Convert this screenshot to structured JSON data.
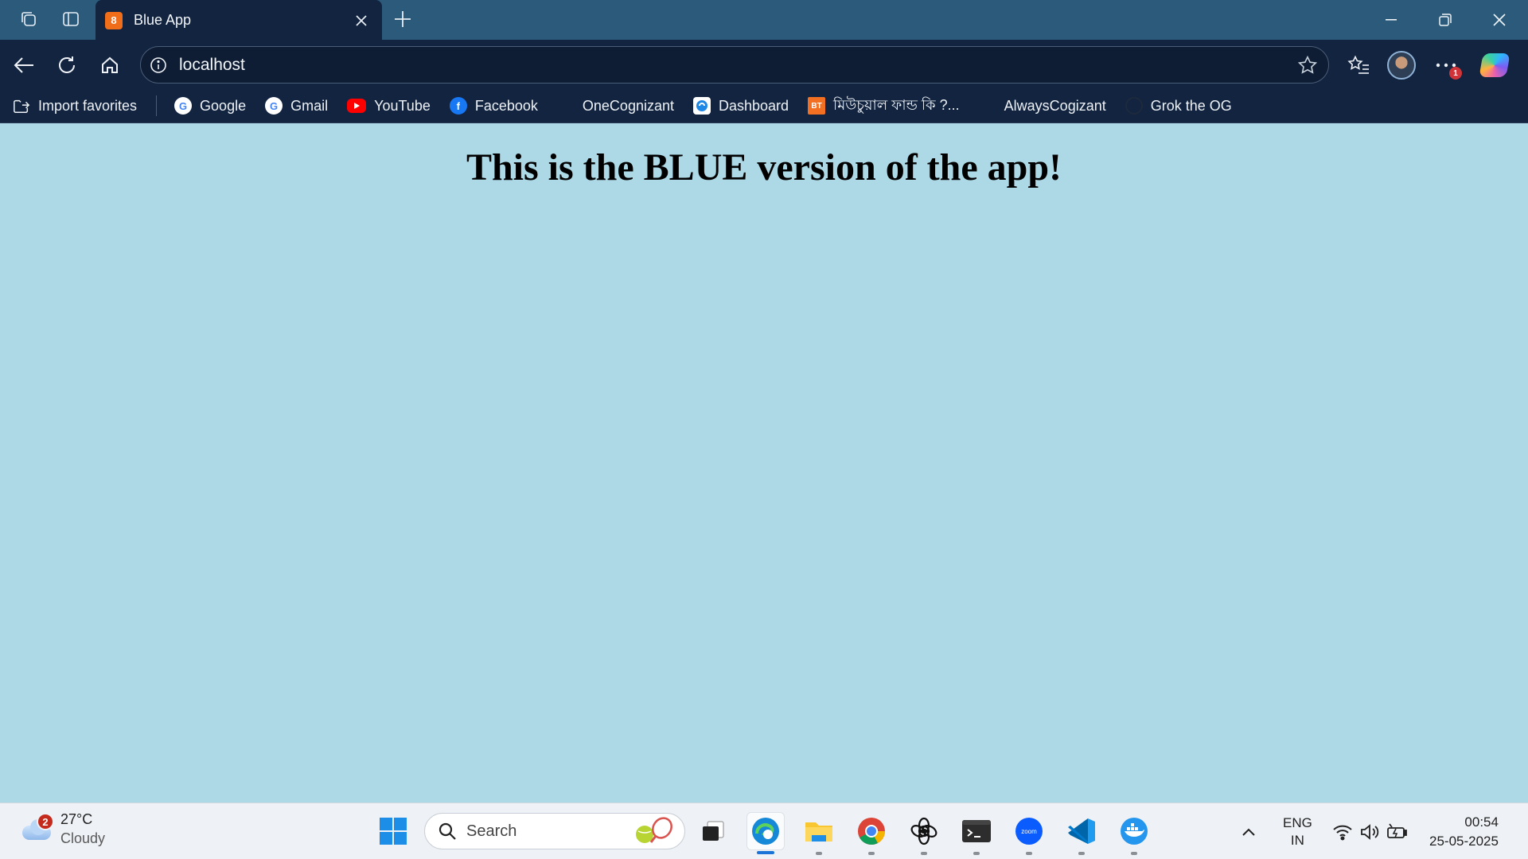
{
  "browser": {
    "tab": {
      "title": "Blue App",
      "favicon_label": "8"
    },
    "address": {
      "url": "localhost"
    },
    "favorites": [
      {
        "label": "Import favorites",
        "icon": "import-favorites-icon"
      },
      {
        "label": "Google",
        "icon": "google-icon"
      },
      {
        "label": "Gmail",
        "icon": "google-icon"
      },
      {
        "label": "YouTube",
        "icon": "youtube-icon"
      },
      {
        "label": "Facebook",
        "icon": "facebook-icon"
      },
      {
        "label": "OneCognizant",
        "icon": "blank-icon"
      },
      {
        "label": "Dashboard",
        "icon": "dashboard-icon"
      },
      {
        "label": "মিউচুয়াল ফান্ড কি ?...",
        "icon": "bt-icon",
        "favicon_text": "BT"
      },
      {
        "label": "AlwaysCogizant",
        "icon": "blank-icon"
      },
      {
        "label": "Grok the OG",
        "icon": "grok-icon"
      }
    ],
    "more_badge": "1"
  },
  "page": {
    "heading": "This is the BLUE version of the app!",
    "background": "#add8e6"
  },
  "taskbar": {
    "weather": {
      "temp": "27°C",
      "condition": "Cloudy",
      "badge": "2"
    },
    "search_label": "Search",
    "lang": {
      "line1": "ENG",
      "line2": "IN"
    },
    "clock": {
      "time": "00:54",
      "date": "25-05-2025"
    },
    "apps": [
      "start",
      "search",
      "task-view",
      "edge",
      "file-explorer",
      "chrome",
      "chatgpt",
      "terminal",
      "zoom",
      "vscode",
      "docker"
    ],
    "zoom_label": "zoom"
  },
  "colors": {
    "titlebar": "#2b5a7a",
    "toolbar": "#122440",
    "accent": "#1a73d6"
  }
}
